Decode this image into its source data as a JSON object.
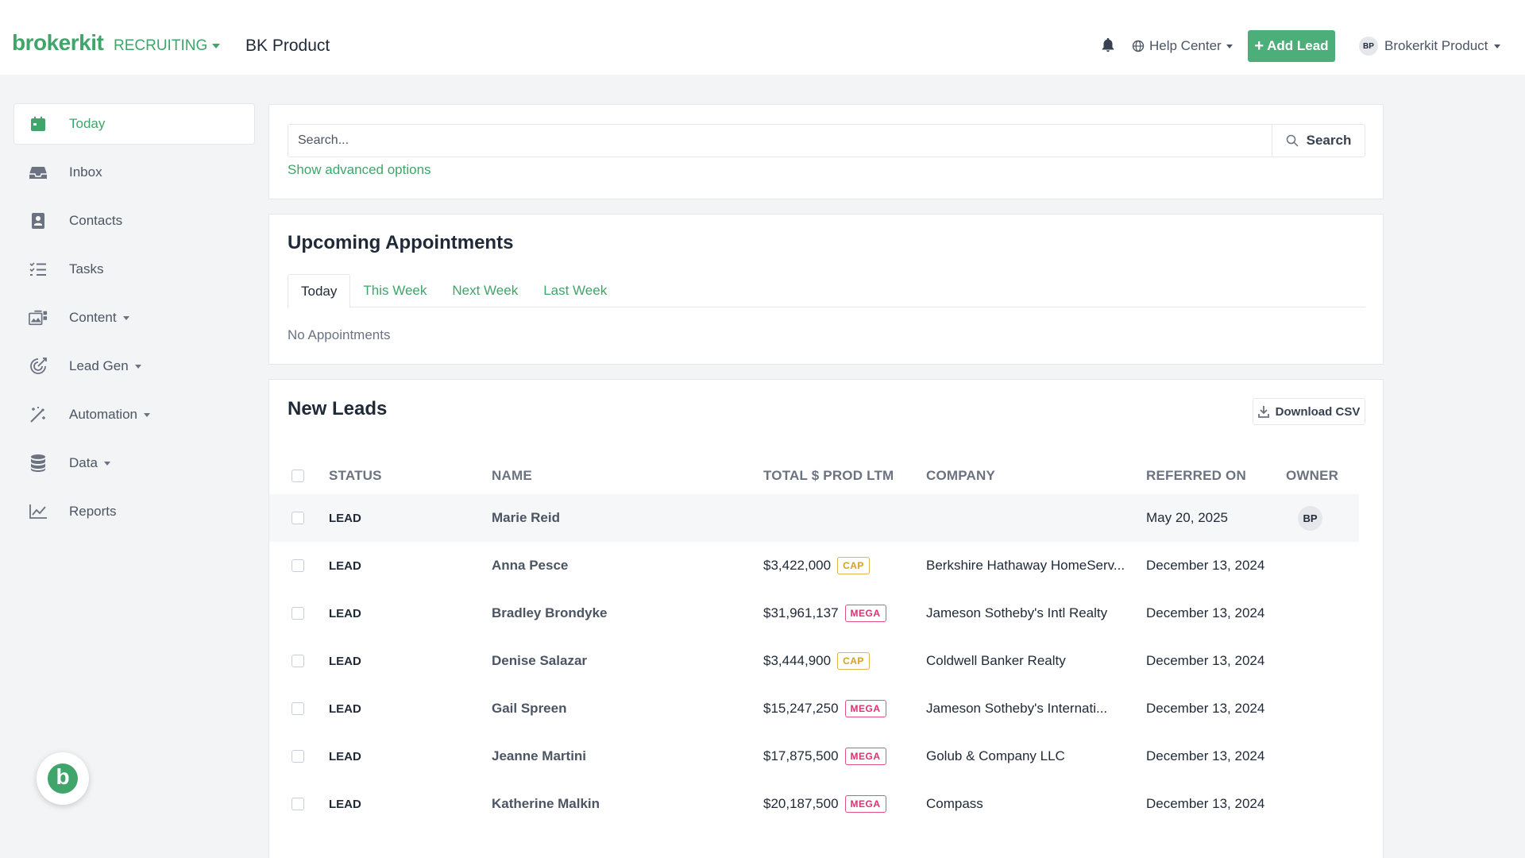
{
  "header": {
    "logo": "brokerkit",
    "module": "RECRUITING",
    "org": "BK Product",
    "help": "Help Center",
    "add_lead": "Add Lead",
    "user": "Brokerkit Product",
    "user_initials": "BP"
  },
  "sidebar": {
    "items": [
      {
        "label": "Today",
        "icon": "calendar-icon"
      },
      {
        "label": "Inbox",
        "icon": "inbox-icon"
      },
      {
        "label": "Contacts",
        "icon": "contacts-icon"
      },
      {
        "label": "Tasks",
        "icon": "tasks-icon"
      },
      {
        "label": "Content",
        "icon": "content-icon"
      },
      {
        "label": "Lead Gen",
        "icon": "lead-gen-icon"
      },
      {
        "label": "Automation",
        "icon": "magic-wand-icon"
      },
      {
        "label": "Data",
        "icon": "database-icon"
      },
      {
        "label": "Reports",
        "icon": "chart-line-icon"
      }
    ],
    "fab_letter": "b"
  },
  "search": {
    "placeholder": "Search...",
    "button": "Search",
    "advanced": "Show advanced options"
  },
  "appointments": {
    "title": "Upcoming Appointments",
    "tabs": [
      "Today",
      "This Week",
      "Next Week",
      "Last Week"
    ],
    "empty": "No Appointments"
  },
  "leads": {
    "title": "New Leads",
    "download": "Download CSV",
    "columns": [
      "STATUS",
      "NAME",
      "TOTAL $ PROD LTM",
      "COMPANY",
      "REFERRED ON",
      "OWNER"
    ],
    "rows": [
      {
        "status": "LEAD",
        "name": "Marie Reid",
        "prod": "",
        "tier": "",
        "company": "",
        "referred": "May 20, 2025",
        "owner": "BP"
      },
      {
        "status": "LEAD",
        "name": "Anna Pesce",
        "prod": "$3,422,000",
        "tier": "CAP",
        "company": "Berkshire Hathaway HomeServ...",
        "referred": "December 13, 2024",
        "owner": ""
      },
      {
        "status": "LEAD",
        "name": "Bradley Brondyke",
        "prod": "$31,961,137",
        "tier": "MEGA",
        "company": "Jameson Sotheby's Intl Realty",
        "referred": "December 13, 2024",
        "owner": ""
      },
      {
        "status": "LEAD",
        "name": "Denise Salazar",
        "prod": "$3,444,900",
        "tier": "CAP",
        "company": "Coldwell Banker Realty",
        "referred": "December 13, 2024",
        "owner": ""
      },
      {
        "status": "LEAD",
        "name": "Gail Spreen",
        "prod": "$15,247,250",
        "tier": "MEGA",
        "company": "Jameson Sotheby's Internati...",
        "referred": "December 13, 2024",
        "owner": ""
      },
      {
        "status": "LEAD",
        "name": "Jeanne Martini",
        "prod": "$17,875,500",
        "tier": "MEGA",
        "company": "Golub & Company LLC",
        "referred": "December 13, 2024",
        "owner": ""
      },
      {
        "status": "LEAD",
        "name": "Katherine Malkin",
        "prod": "$20,187,500",
        "tier": "MEGA",
        "company": "Compass",
        "referred": "December 13, 2024",
        "owner": ""
      }
    ]
  },
  "colors": {
    "brand": "#3fa56a",
    "cap": "#d6a11f",
    "mega": "#d9346e"
  }
}
